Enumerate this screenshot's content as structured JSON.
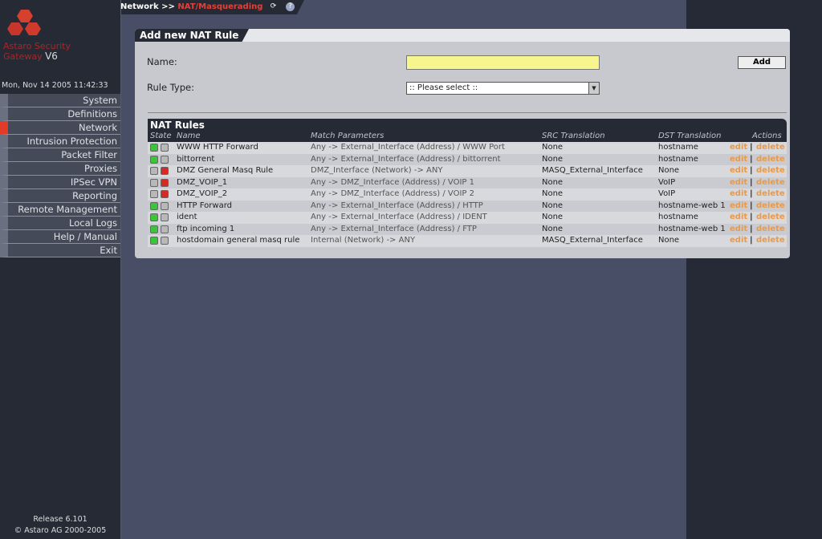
{
  "brand": {
    "line1": "Astaro Security",
    "line2": "Gateway",
    "version": "V6",
    "date": "Mon, Nov 14 2005 11:42:33"
  },
  "breadcrumb": {
    "section": "Network",
    "separator": ">>",
    "current": "NAT/Masquerading"
  },
  "sidebar": {
    "items": [
      {
        "label": "System"
      },
      {
        "label": "Definitions"
      },
      {
        "label": "Network",
        "active": true
      },
      {
        "label": "Intrusion Protection"
      },
      {
        "label": "Packet Filter"
      },
      {
        "label": "Proxies"
      },
      {
        "label": "IPSec VPN"
      },
      {
        "label": "Reporting"
      },
      {
        "label": "Remote Management"
      },
      {
        "label": "Local Logs"
      },
      {
        "label": "Help / Manual"
      },
      {
        "label": "Exit"
      }
    ],
    "release": "Release 6.101",
    "copyright": "© Astaro AG 2000-2005"
  },
  "form": {
    "title": "Add new NAT Rule",
    "name_label": "Name:",
    "name_value": "",
    "add_label": "Add",
    "rule_type_label": "Rule Type:",
    "rule_type_value": ":: Please select ::"
  },
  "table": {
    "title": "NAT Rules",
    "headers": {
      "state": "State",
      "name": "Name",
      "match": "Match Parameters",
      "src": "SRC Translation",
      "dst": "DST Translation",
      "actions": "Actions"
    },
    "edit_label": "edit",
    "delete_label": "delete",
    "action_sep": "|",
    "rows": [
      {
        "state": [
          "on",
          "off"
        ],
        "name": "WWW HTTP Forward",
        "match": "Any -> External_Interface (Address) / WWW Port",
        "src": "None",
        "dst": "hostname"
      },
      {
        "state": [
          "on",
          "off"
        ],
        "name": "bittorrent",
        "match": "Any -> External_Interface (Address) / bittorrent",
        "src": "None",
        "dst": "hostname"
      },
      {
        "state": [
          "off",
          "red"
        ],
        "name": "DMZ General Masq Rule",
        "match": "DMZ_Interface (Network) -> ANY",
        "src": "MASQ_External_Interface",
        "dst": "None"
      },
      {
        "state": [
          "off",
          "red"
        ],
        "name": "DMZ_VOIP_1",
        "match": "Any -> DMZ_Interface (Address) / VOIP 1",
        "src": "None",
        "dst": "VoIP"
      },
      {
        "state": [
          "off",
          "red"
        ],
        "name": "DMZ_VOIP_2",
        "match": "Any -> DMZ_Interface (Address) / VOIP 2",
        "src": "None",
        "dst": "VoIP"
      },
      {
        "state": [
          "on",
          "off"
        ],
        "name": "HTTP Forward",
        "match": "Any -> External_Interface (Address) / HTTP",
        "src": "None",
        "dst": "hostname-web 1"
      },
      {
        "state": [
          "on",
          "off"
        ],
        "name": "ident",
        "match": "Any -> External_Interface (Address) / IDENT",
        "src": "None",
        "dst": "hostname"
      },
      {
        "state": [
          "on",
          "off"
        ],
        "name": "ftp incoming 1",
        "match": "Any -> External_Interface (Address) / FTP",
        "src": "None",
        "dst": "hostname-web 1"
      },
      {
        "state": [
          "on",
          "off"
        ],
        "name": "hostdomain general masq rule",
        "match": "Internal (Network) -> ANY",
        "src": "MASQ_External_Interface",
        "dst": "None"
      }
    ]
  },
  "colors": {
    "accent": "#e23b2a",
    "action": "#e89a4a",
    "active_state": "#3ec43a",
    "inactive_state": "#d82a22"
  }
}
